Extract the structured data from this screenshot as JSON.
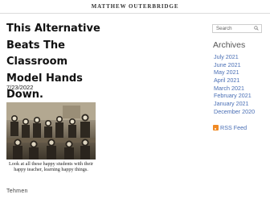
{
  "header": {
    "site_title": "MATTHEW OUTERBRIDGE"
  },
  "post": {
    "title": "This Alternative Beats The Classroom Model Hands Down.",
    "date": "7/23/2022",
    "caption": "Look at all these happy students with their happy teacher, learning happy things.",
    "tags_label": "Tehmen"
  },
  "sidebar": {
    "search_placeholder": "Search",
    "archives_heading": "Archives",
    "archives": [
      "July 2021",
      "June 2021",
      "May 2021",
      "April 2021",
      "March 2021",
      "February 2021",
      "January 2021",
      "December 2020"
    ],
    "rss_label": "RSS Feed"
  }
}
